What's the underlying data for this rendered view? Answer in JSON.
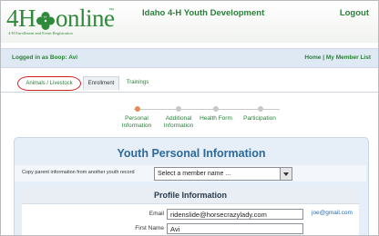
{
  "header": {
    "logo_text": "4H",
    "logo_text_2": "online",
    "logo_tm": "™",
    "logo_sub": "4-H Enrollment and Event Registration",
    "site_title": "Idaho 4-H Youth Development",
    "logout": "Logout",
    "colors": {
      "brand_green": "#2f8a3a"
    }
  },
  "logged_bar": {
    "who": "Logged in as Boop: Avi",
    "home": "Home",
    "separator": "|",
    "my_member_list": "My Member List"
  },
  "tabs": [
    {
      "label": "Animals / Livestock",
      "highlighted": true
    },
    {
      "label": "Enrollment",
      "active": true
    },
    {
      "label": "Trainings"
    }
  ],
  "progress": {
    "steps": [
      {
        "label": "Personal Information",
        "line1": "Personal",
        "line2": "Information",
        "active": true
      },
      {
        "label": "Additional Information",
        "line1": "Additional",
        "line2": "Information"
      },
      {
        "label": "Health Form"
      },
      {
        "label": "Participation"
      }
    ]
  },
  "panel": {
    "title": "Youth Personal Information",
    "copy_label": "Copy parent information from another youth record",
    "copy_select_value": "Select a member name ...",
    "sub_title": "Profile Information",
    "email_label": "Email",
    "email_value": "ridenslide@horsecrazylady.com",
    "email_hint": "joe@gmail.com",
    "first_name_label": "First Name",
    "first_name_value": "Avi"
  }
}
